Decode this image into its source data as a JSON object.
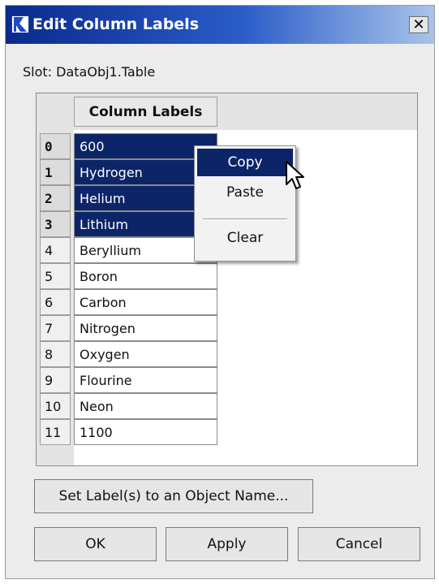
{
  "window": {
    "title": "Edit Column Labels",
    "close_label": "✕"
  },
  "slot": {
    "label": "Slot: DataObj1.Table"
  },
  "table": {
    "column_header": "Column Labels",
    "rows": [
      {
        "index": "0",
        "value": "600",
        "selected": true
      },
      {
        "index": "1",
        "value": "Hydrogen",
        "selected": true
      },
      {
        "index": "2",
        "value": "Helium",
        "selected": true
      },
      {
        "index": "3",
        "value": "Lithium",
        "selected": true
      },
      {
        "index": "4",
        "value": "Beryllium",
        "selected": false
      },
      {
        "index": "5",
        "value": "Boron",
        "selected": false
      },
      {
        "index": "6",
        "value": "Carbon",
        "selected": false
      },
      {
        "index": "7",
        "value": "Nitrogen",
        "selected": false
      },
      {
        "index": "8",
        "value": "Oxygen",
        "selected": false
      },
      {
        "index": "9",
        "value": "Flourine",
        "selected": false
      },
      {
        "index": "10",
        "value": "Neon",
        "selected": false
      },
      {
        "index": "11",
        "value": "1100",
        "selected": false
      }
    ]
  },
  "context_menu": {
    "items": [
      {
        "label": "Copy",
        "active": true
      },
      {
        "label": "Paste",
        "active": false
      },
      {
        "label": "Clear",
        "active": false
      }
    ]
  },
  "buttons": {
    "set_label": "Set Label(s) to an Object Name...",
    "ok": "OK",
    "apply": "Apply",
    "cancel": "Cancel"
  },
  "colors": {
    "selection": "#0c2569",
    "title_gradient_start": "#0a2a8c",
    "title_gradient_end": "#a9c4ea"
  },
  "icons": {
    "app": "riverware-icon",
    "close": "close-icon",
    "cursor": "mouse-pointer-icon"
  }
}
